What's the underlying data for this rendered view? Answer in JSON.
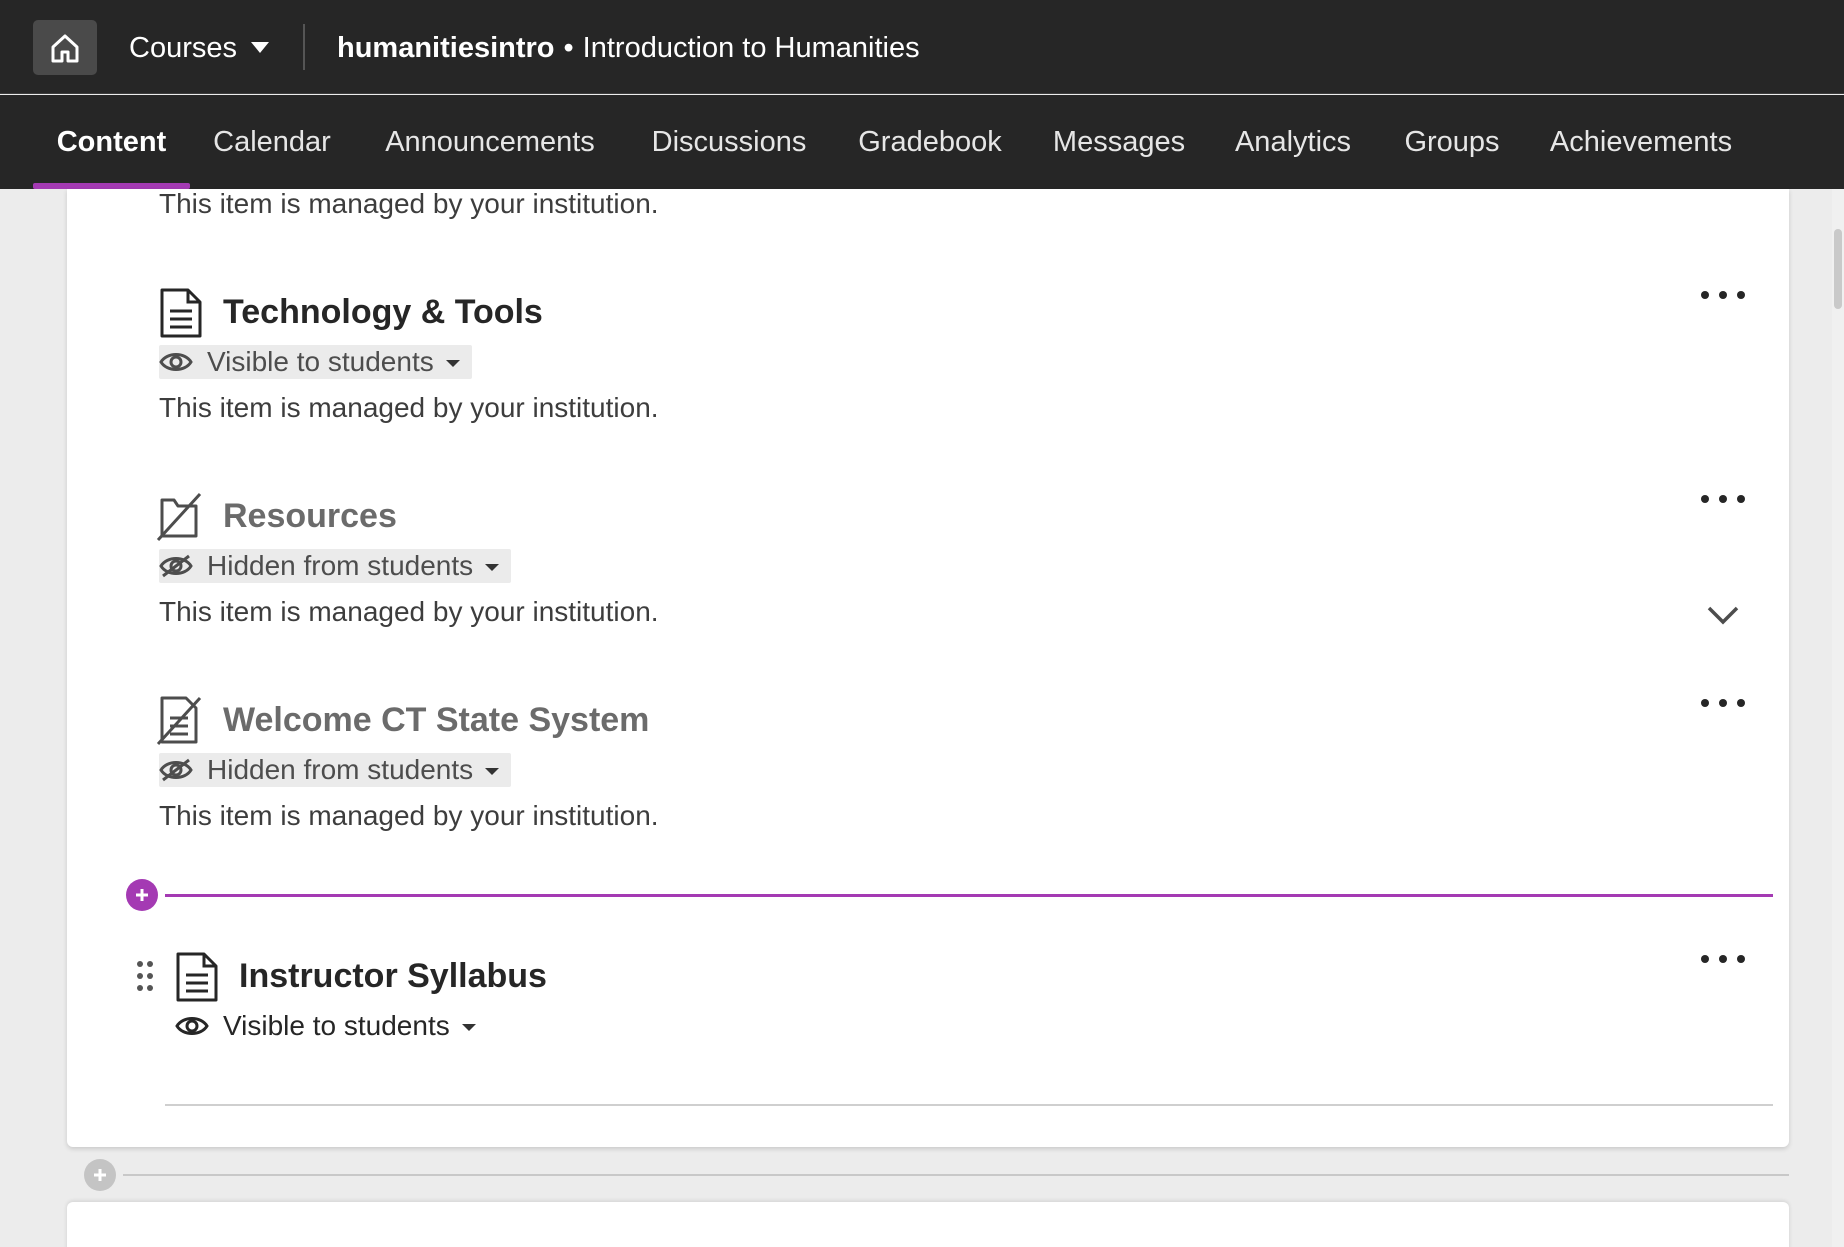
{
  "header": {
    "courses_label": "Courses",
    "course_code": "humanitiesintro",
    "separator": "•",
    "course_name": "Introduction to Humanities"
  },
  "nav": {
    "tabs": [
      {
        "label": "Content",
        "active": true
      },
      {
        "label": "Calendar"
      },
      {
        "label": "Announcements"
      },
      {
        "label": "Discussions"
      },
      {
        "label": "Gradebook"
      },
      {
        "label": "Messages"
      },
      {
        "label": "Analytics"
      },
      {
        "label": "Groups"
      },
      {
        "label": "Achievements"
      }
    ]
  },
  "colors": {
    "accent": "#a43ab3",
    "topbar": "#262626"
  },
  "content": {
    "top_managed_text": "This item is managed by your institution.",
    "items": [
      {
        "title": "Technology & Tools",
        "icon": "document-icon",
        "visibility": "Visible to students",
        "managed": "This item is managed by your institution."
      },
      {
        "title": "Resources",
        "icon": "folder-hidden-icon",
        "visibility": "Hidden from students",
        "managed": "This item is managed by your institution."
      },
      {
        "title": "Welcome CT State System",
        "icon": "document-hidden-icon",
        "visibility": "Hidden from students",
        "managed": "This item is managed by your institution."
      },
      {
        "title": "Instructor Syllabus",
        "icon": "document-icon",
        "visibility": "Visible to students"
      }
    ]
  }
}
